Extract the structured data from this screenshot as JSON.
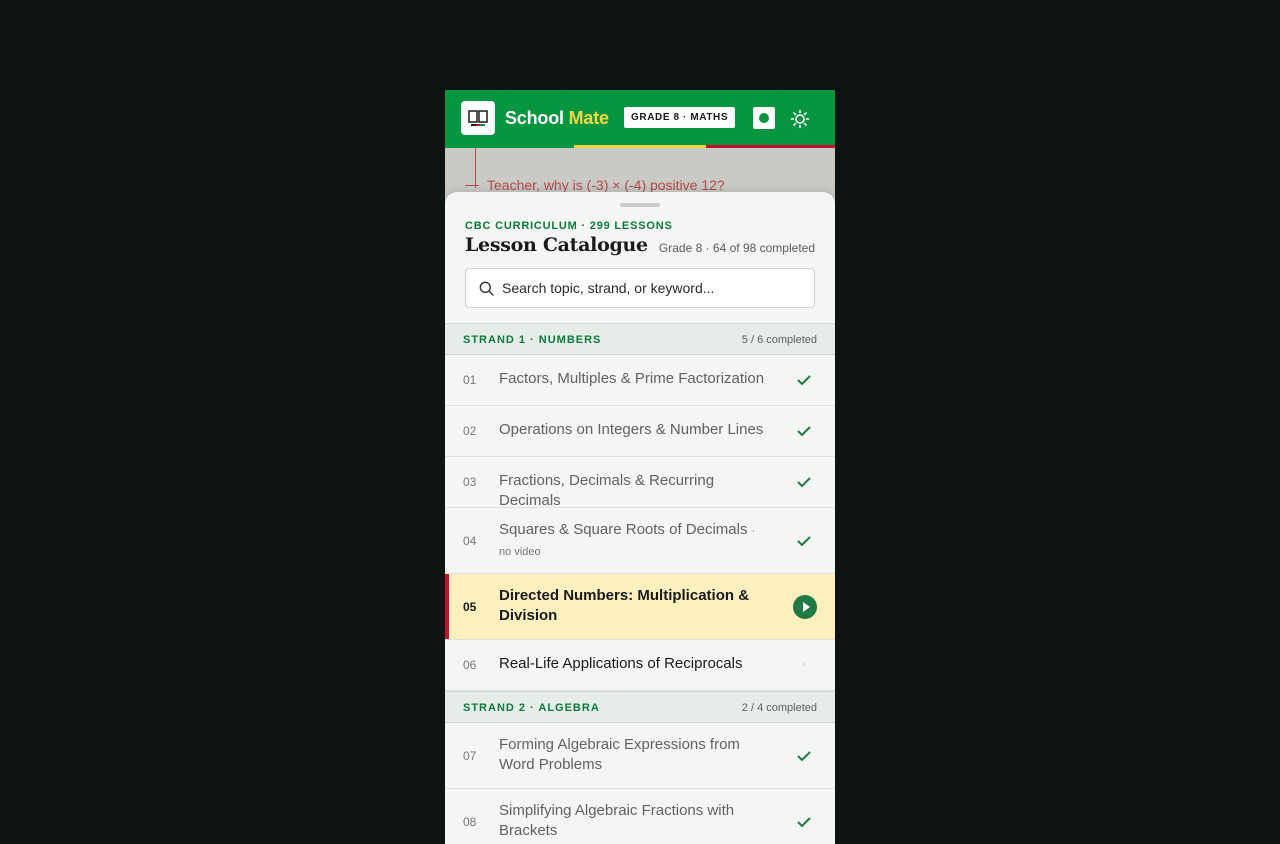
{
  "header": {
    "brand_school": "School",
    "brand_mate": "Mate",
    "grade_chip": "GRADE 8 · MATHS",
    "icons": {
      "logo": "open-book-icon",
      "record": "record-icon",
      "theme": "sun-icon"
    },
    "colors": {
      "bar": "#07963f",
      "accent_yellow": "#f6d645",
      "accent_red": "#c8102e"
    }
  },
  "background_lesson": {
    "question": "Teacher, why is (-3) × (-4) positive 12?"
  },
  "sheet": {
    "eyebrow": "CBC CURRICULUM · 299 LESSONS",
    "title": "Lesson Catalogue",
    "meta": "Grade 8 · 64 of 98 completed",
    "search_placeholder": "Search topic, strand, or keyword..."
  },
  "strands": [
    {
      "name": "STRAND 1 · NUMBERS",
      "count": "5 / 6 completed",
      "lessons": [
        {
          "num": "01",
          "title": "Factors, Multiples & Prime Factorization",
          "status": "completed"
        },
        {
          "num": "02",
          "title": "Operations on Integers & Number Lines",
          "status": "completed"
        },
        {
          "num": "03",
          "title": "Fractions, Decimals & Recurring Decimals",
          "status": "completed"
        },
        {
          "num": "04",
          "title": "Squares & Square Roots of Decimals",
          "note": "· no video",
          "status": "completed"
        },
        {
          "num": "05",
          "title": "Directed Numbers: Multiplication & Division",
          "status": "current"
        },
        {
          "num": "06",
          "title": "Real-Life Applications of Reciprocals",
          "status": "pending"
        }
      ]
    },
    {
      "name": "STRAND 2 · ALGEBRA",
      "count": "2 / 4 completed",
      "lessons": [
        {
          "num": "07",
          "title": "Forming Algebraic Expressions from Word Problems",
          "status": "completed"
        },
        {
          "num": "08",
          "title": "Simplifying Algebraic Fractions with Brackets",
          "status": "completed"
        }
      ]
    }
  ]
}
